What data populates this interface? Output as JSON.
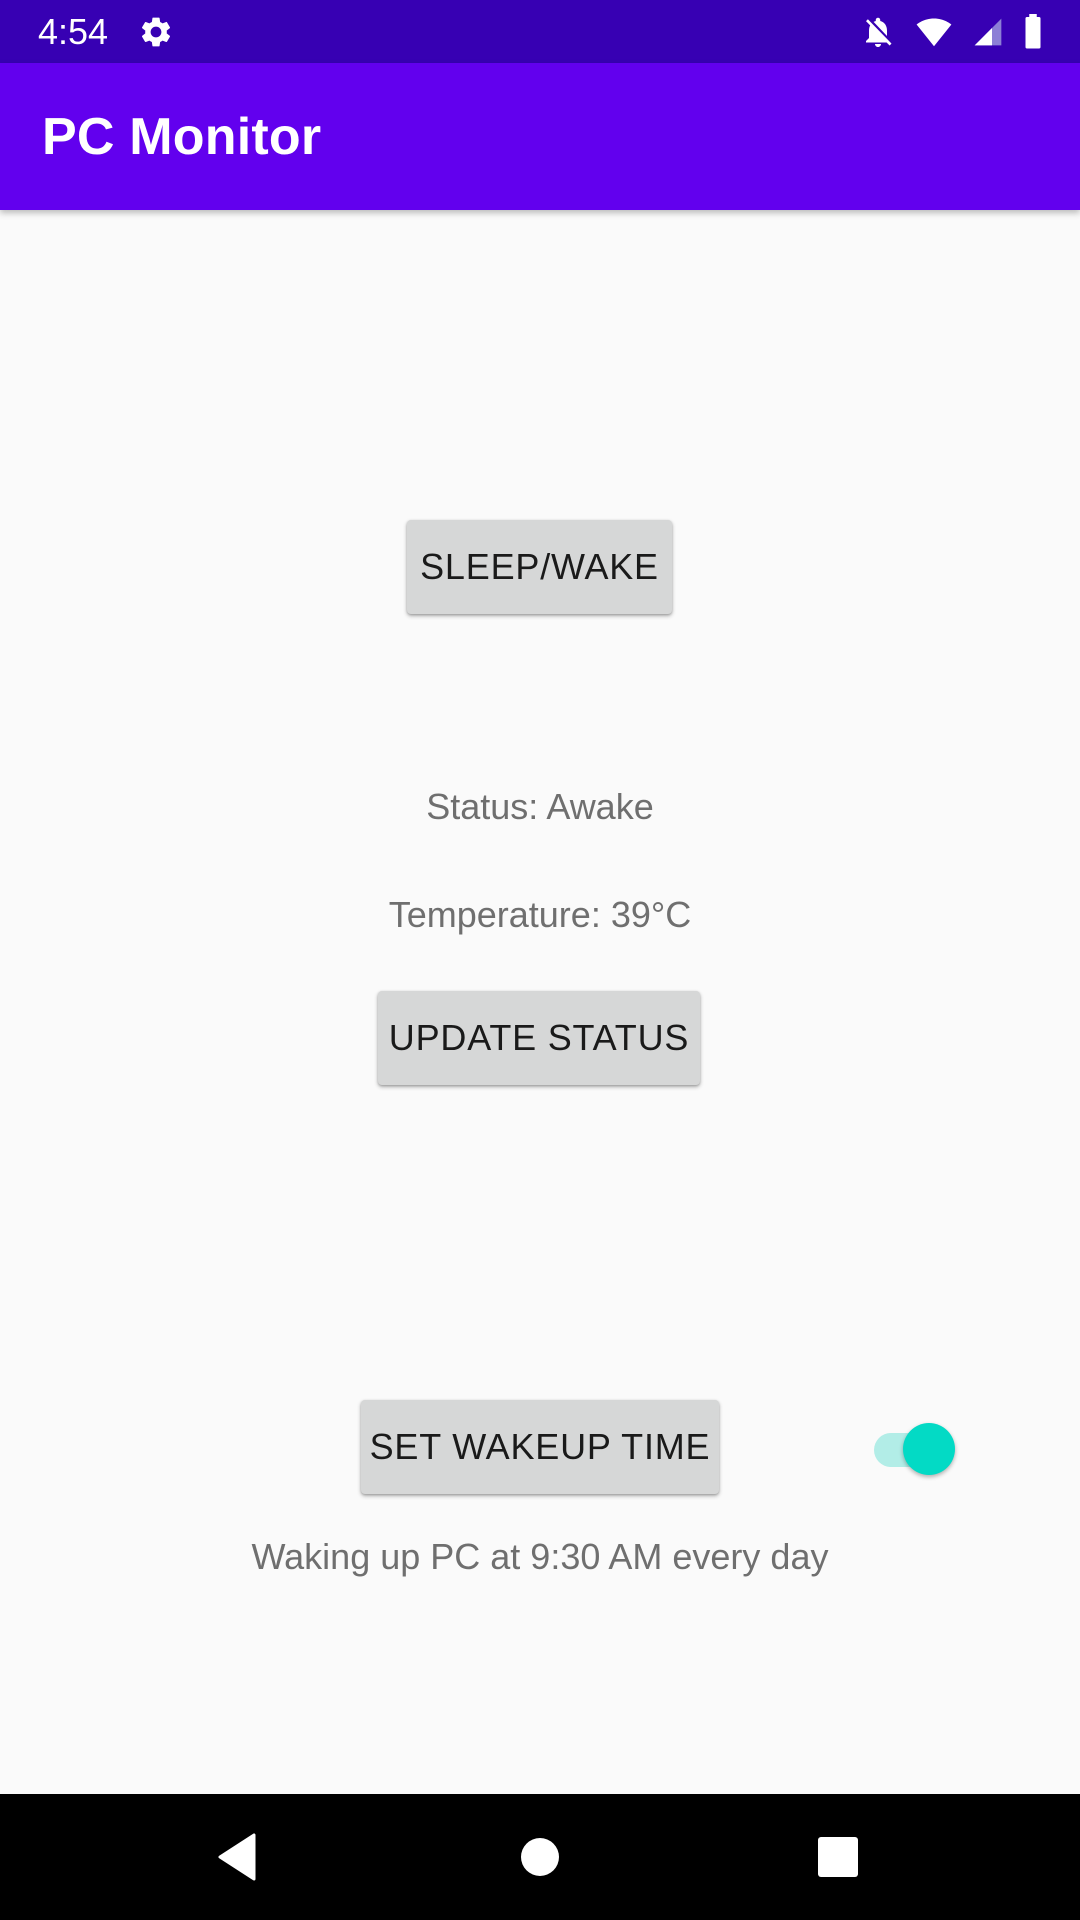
{
  "status_bar": {
    "time": "4:54",
    "icons": [
      "settings-gear-icon",
      "notifications-off-icon",
      "wifi-icon",
      "cell-signal-icon",
      "battery-icon"
    ]
  },
  "app_bar": {
    "title": "PC Monitor",
    "background_color": "#6200ee",
    "status_bar_color": "#3700b3"
  },
  "main": {
    "sleep_wake_button": "SLEEP/WAKE",
    "status_text": "Status: Awake",
    "temperature_text": "Temperature: 39°C",
    "update_status_button": "UPDATE STATUS",
    "set_wakeup_button": "SET WAKEUP TIME",
    "wakeup_toggle_on": true,
    "wakeup_info_text": "Waking up PC at 9:30 AM every day",
    "accent_color": "#03dac5"
  },
  "nav_bar": {
    "buttons": [
      "back-icon",
      "home-icon",
      "recent-apps-icon"
    ]
  }
}
